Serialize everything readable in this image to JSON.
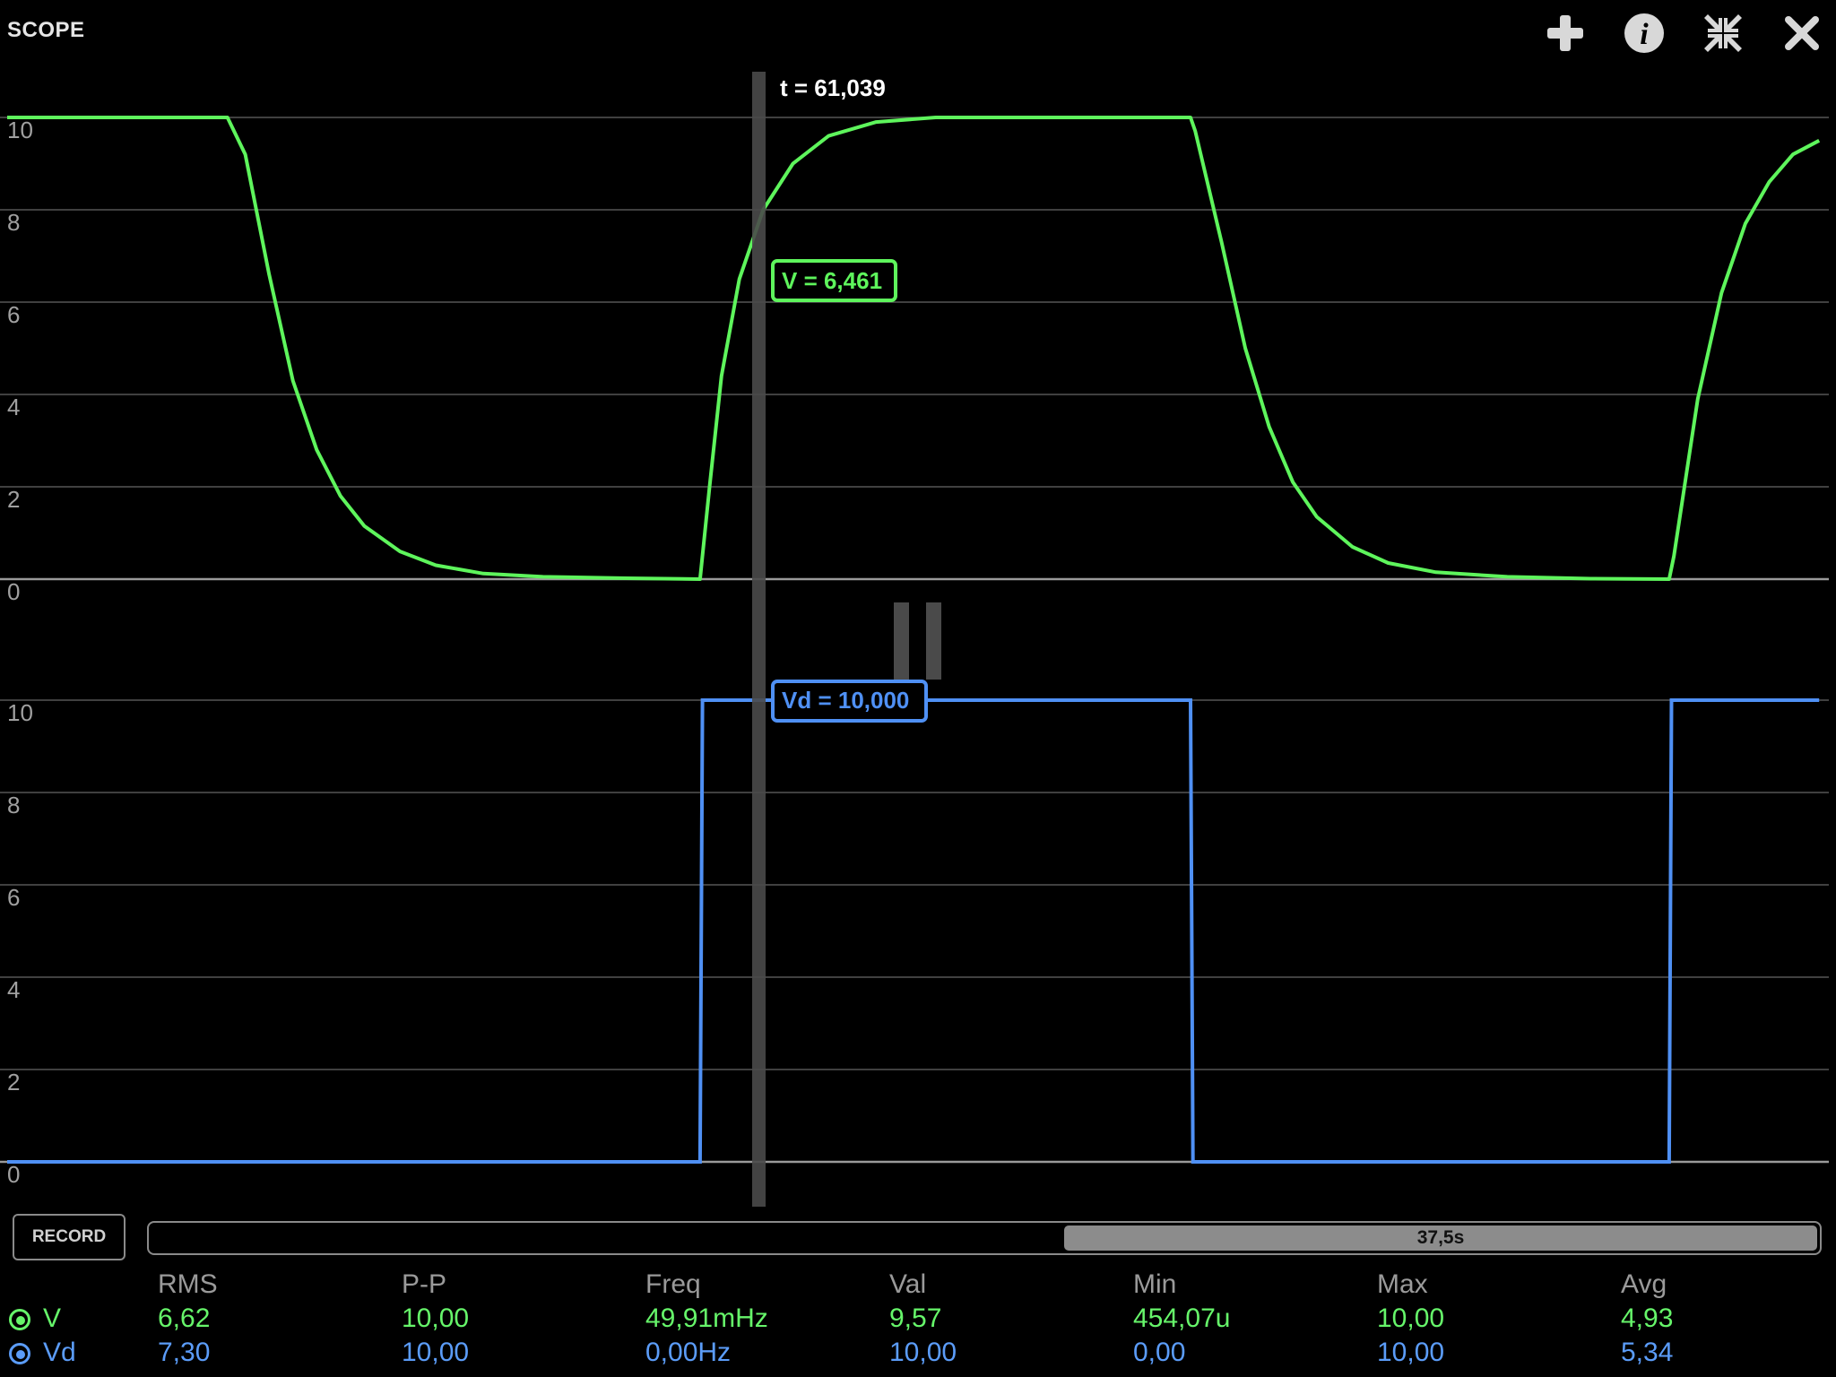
{
  "app": {
    "title": "SCOPE"
  },
  "toolbar": {
    "icons": [
      "plus-icon",
      "info-icon",
      "collapse-icon",
      "close-icon"
    ]
  },
  "colors": {
    "v": "#5ef55c",
    "vd": "#4f90f4",
    "grid": "#555555",
    "axis": "#9a9a9a",
    "cursor": "#4a4a4a"
  },
  "scope": {
    "time_label": "t = 61,039",
    "tick_labels": [
      "0",
      "2",
      "4",
      "6",
      "8",
      "10"
    ],
    "cursor_v_label": "V = 6,461",
    "cursor_vd_label": "Vd = 10,000",
    "paused": true
  },
  "chart_data": [
    {
      "type": "line",
      "series": [
        {
          "name": "V"
        }
      ],
      "ylim": [
        0,
        10
      ],
      "grid": true,
      "yticks": [
        0,
        2,
        4,
        6,
        8,
        10
      ],
      "cursor": {
        "t": 61.039,
        "value": 6.461
      },
      "points": [
        [
          0,
          10
        ],
        [
          0.185,
          10
        ],
        [
          0.2,
          9.2
        ],
        [
          0.22,
          6.6
        ],
        [
          0.24,
          4.3
        ],
        [
          0.26,
          2.8
        ],
        [
          0.28,
          1.8
        ],
        [
          0.3,
          1.15
        ],
        [
          0.33,
          0.6
        ],
        [
          0.36,
          0.3
        ],
        [
          0.4,
          0.12
        ],
        [
          0.45,
          0.05
        ],
        [
          0.52,
          0.02
        ],
        [
          0.582,
          0
        ],
        [
          0.59,
          2.0
        ],
        [
          0.6,
          4.4
        ],
        [
          0.615,
          6.5
        ],
        [
          0.635,
          8.0
        ],
        [
          0.66,
          9.0
        ],
        [
          0.69,
          9.6
        ],
        [
          0.73,
          9.9
        ],
        [
          0.78,
          10
        ],
        [
          0.994,
          10
        ],
        [
          0.998,
          9.7
        ],
        [
          1.02,
          7.3
        ],
        [
          1.04,
          5.0
        ],
        [
          1.06,
          3.3
        ],
        [
          1.08,
          2.1
        ],
        [
          1.1,
          1.35
        ],
        [
          1.13,
          0.7
        ],
        [
          1.16,
          0.35
        ],
        [
          1.2,
          0.15
        ],
        [
          1.26,
          0.05
        ],
        [
          1.33,
          0.01
        ],
        [
          1.396,
          0
        ],
        [
          1.4,
          0.5
        ],
        [
          1.42,
          3.9
        ],
        [
          1.44,
          6.2
        ],
        [
          1.46,
          7.7
        ],
        [
          1.48,
          8.6
        ],
        [
          1.5,
          9.2
        ],
        [
          1.522,
          9.5
        ]
      ]
    },
    {
      "type": "line",
      "series": [
        {
          "name": "Vd"
        }
      ],
      "ylim": [
        0,
        10
      ],
      "grid": true,
      "yticks": [
        0,
        2,
        4,
        6,
        8,
        10
      ],
      "cursor": {
        "t": 61.039,
        "value": 10.0
      },
      "points": [
        [
          0,
          0
        ],
        [
          0.582,
          0
        ],
        [
          0.584,
          10
        ],
        [
          0.994,
          10
        ],
        [
          0.996,
          0
        ],
        [
          1.396,
          0
        ],
        [
          1.398,
          10
        ],
        [
          1.522,
          10
        ]
      ]
    }
  ],
  "controls": {
    "record_label": "RECORD",
    "timeline_label": "37,5s"
  },
  "stats": {
    "headers": [
      "RMS",
      "P-P",
      "Freq",
      "Val",
      "Min",
      "Max",
      "Avg"
    ],
    "rows": [
      {
        "name": "V",
        "color": "#66f56a",
        "values": [
          "6,62",
          "10,00",
          "49,91mHz",
          "9,57",
          "454,07u",
          "10,00",
          "4,93"
        ]
      },
      {
        "name": "Vd",
        "color": "#5b9cf8",
        "values": [
          "7,30",
          "10,00",
          "0,00Hz",
          "10,00",
          "0,00",
          "10,00",
          "5,34"
        ]
      }
    ]
  }
}
